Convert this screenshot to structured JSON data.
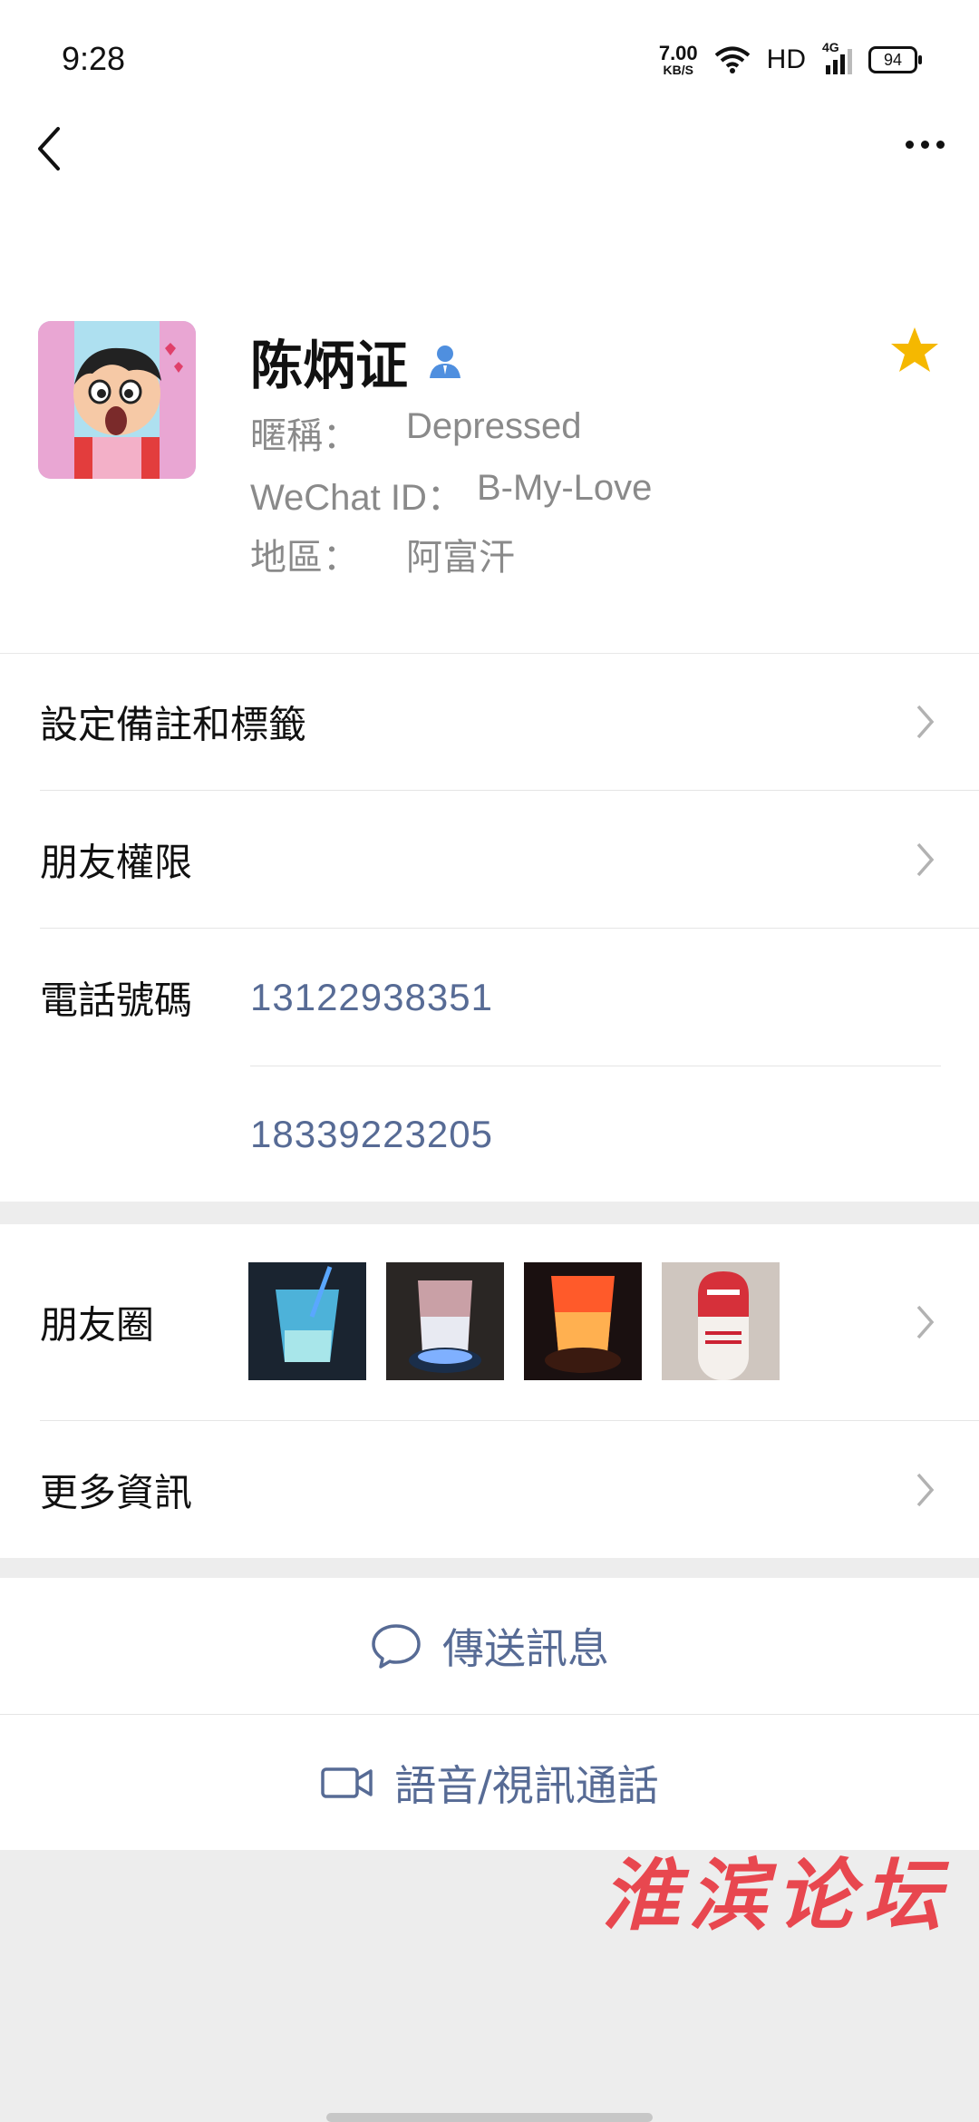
{
  "status_bar": {
    "time": "9:28",
    "net_speed_value": "7.00",
    "net_speed_unit": "KB/S",
    "hd": "HD",
    "network": "4G",
    "battery": "94"
  },
  "profile": {
    "name": "陈炳证",
    "nickname_label": "暱稱：",
    "nickname": "Depressed",
    "wechat_id_label": "WeChat ID：",
    "wechat_id": "B-My-Love",
    "region_label": "地區：",
    "region": "阿富汗",
    "starred": true
  },
  "menu": {
    "remarks_tags": "設定備註和標籤",
    "friend_permissions": "朋友權限",
    "phone_label": "電話號碼",
    "phones": [
      "13122938351",
      "18339223205"
    ],
    "moments": "朋友圈",
    "more_info": "更多資訊"
  },
  "actions": {
    "send_message": "傳送訊息",
    "voice_video_call": "語音/視訊通話"
  },
  "watermark": "淮滨论坛",
  "colors": {
    "link": "#576b95",
    "star": "#f5b800",
    "watermark": "#e8474f"
  }
}
